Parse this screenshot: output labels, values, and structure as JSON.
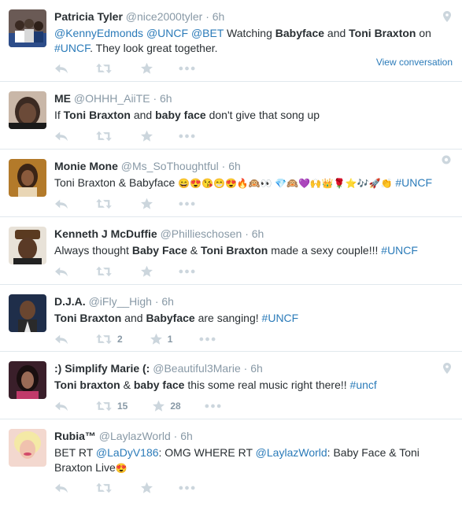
{
  "tweets": [
    {
      "name": "Patricia Tyler",
      "handle": "@nice2000tyler",
      "time": "6h",
      "m1": "@KennyEdmonds",
      "m2": "@UNCF",
      "m3": "@BET",
      "t1": " Watching ",
      "b1": "Babyface",
      "t2": " and ",
      "b2": "Toni Braxton",
      "t3": " on",
      "tag": "#UNCF",
      "t4": ".  They look great together.",
      "view_conversation": "View conversation"
    },
    {
      "name": "ME",
      "handle": "@OHHH_AiiTE",
      "time": "6h",
      "t1": "If ",
      "b1": "Toni Braxton",
      "t2": " and ",
      "b2": "baby face",
      "t3": " don't give that song up"
    },
    {
      "name": "Monie Mone",
      "handle": "@Ms_SoThoughtful",
      "time": "6h",
      "t1": "Toni Braxton & Babyface ",
      "emoji": "😄😍😘😁😍🔥🙉👀 💎🙉💜🙌👑🌹⭐🎶🚀👏",
      "tag": "#UNCF"
    },
    {
      "name": "Kenneth J McDuffie",
      "handle": "@Philliesch​osen",
      "time": "6h",
      "t1": "Always thought ",
      "b1": "Baby Face",
      "t2": " & ",
      "b2": "Toni Braxton",
      "t3": " made a sexy couple!!! ",
      "tag": "#UNCF"
    },
    {
      "name": "D.J.A.",
      "handle": "@iFly__High",
      "time": "6h",
      "b1": "Toni Braxton",
      "t1": " and ",
      "b2": "Babyface",
      "t2": " are sanging! ",
      "tag": "#UNCF",
      "retweets": "2",
      "favorites": "1"
    },
    {
      "name": ":) Simplify Marie (:",
      "handle": "@Beautiful3Marie",
      "time": "6h",
      "b1": "Toni braxton",
      "t1": " & ",
      "b2": "baby face",
      "t2": " this some real music right there!! ",
      "tag": "#uncf",
      "retweets": "15",
      "favorites": "28"
    },
    {
      "name": "Rubia™",
      "handle": "@LaylazWorld",
      "time": "6h",
      "t1": "BET RT ",
      "m1": "@LaDyV186",
      "t2": ": OMG WHERE  RT ",
      "m2": "@LaylazWorld",
      "t3": ": Baby Face & Toni",
      "t4": "Braxton Live",
      "emoji": "😍"
    }
  ],
  "sep": "·",
  "colors": {
    "link": "#2b7bb9",
    "meta": "#8899a6",
    "icon": "#ccd6dd",
    "border": "#e1e8ed"
  },
  "icons": [
    "reply-icon",
    "retweet-icon",
    "favorite-icon",
    "more-icon",
    "geo-pin-icon",
    "media-icon"
  ]
}
